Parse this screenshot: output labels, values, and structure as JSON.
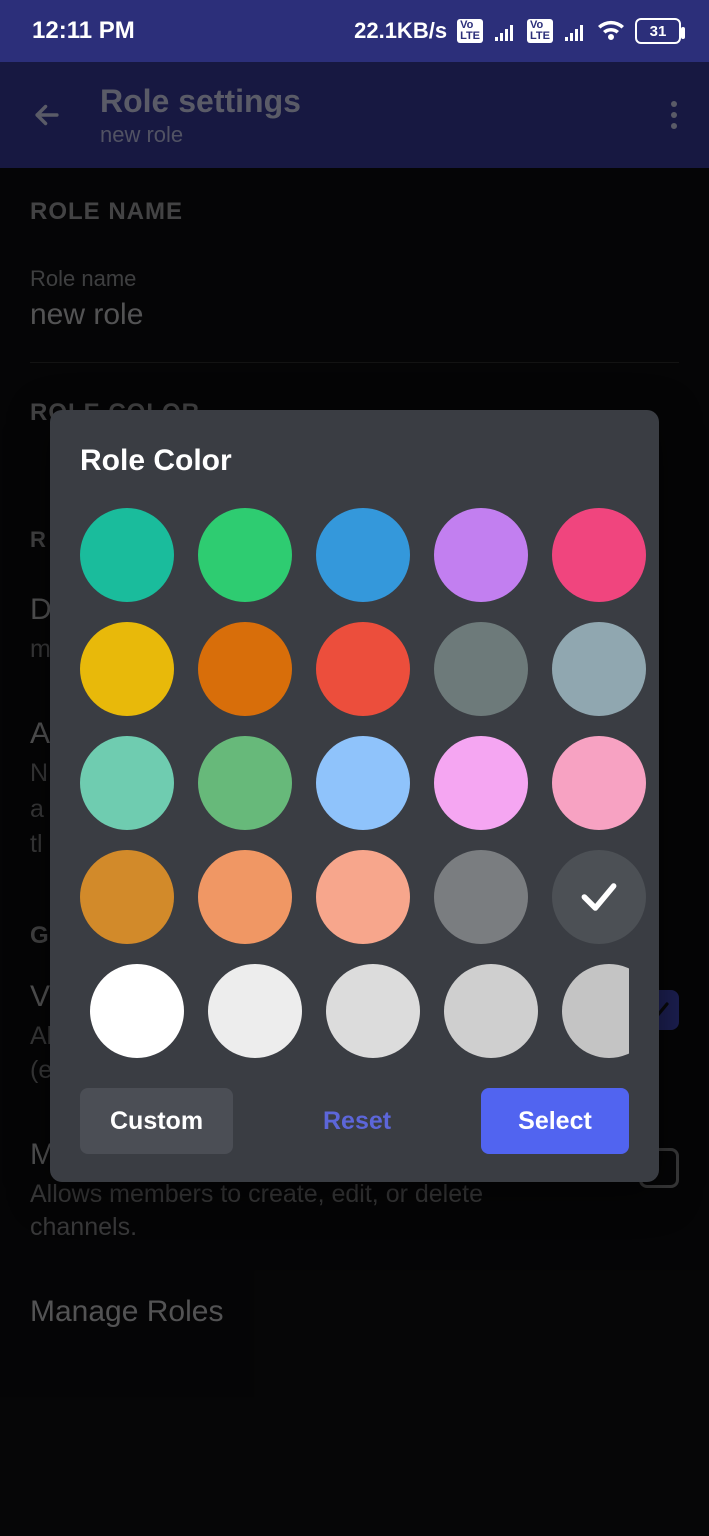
{
  "status": {
    "time": "12:11 PM",
    "speed": "22.1KB/s",
    "battery": "31"
  },
  "header": {
    "title": "Role settings",
    "subtitle": "new role"
  },
  "sections": {
    "roleName": {
      "header": "ROLE NAME",
      "fieldLabel": "Role name",
      "fieldValue": "new role"
    },
    "roleColor": {
      "header": "ROLE COLOR"
    },
    "roleSettings": {
      "header": "ROLE SETTINGS"
    }
  },
  "perms": {
    "display": {
      "prefix": "D",
      "descPrefix": "m"
    },
    "allowMention": {
      "prefix": "A",
      "line1": "N",
      "line2": "a",
      "line3": "tl"
    },
    "general": {
      "prefix": "G"
    },
    "viewChannels": {
      "title": "View Channels",
      "desc": "Allows members to view channels by default (excluding private channels).",
      "checked": true
    },
    "manageChannels": {
      "title": "Manage Channels",
      "desc": "Allows members to create, edit, or delete channels.",
      "checked": false
    },
    "manageRoles": {
      "title": "Manage Roles"
    }
  },
  "dialog": {
    "title": "Role Color",
    "buttons": {
      "custom": "Custom",
      "reset": "Reset",
      "select": "Select"
    },
    "colors": [
      [
        "#1abc9c",
        "#2ecc71",
        "#3498db",
        "#c27ff0",
        "#f0457e"
      ],
      [
        "#e8b90a",
        "#d86e0a",
        "#ec4e3c",
        "#6d7a7a",
        "#90a7b0"
      ],
      [
        "#6fccb0",
        "#67b97a",
        "#8fc3fb",
        "#f5a6f2",
        "#f7a2c2"
      ],
      [
        "#d28a2a",
        "#f09764",
        "#f7a68c",
        "#7a7d80",
        "#4c5055"
      ]
    ],
    "selectedIndex": [
      3,
      4
    ],
    "extraColors": [
      "#ffffff",
      "#ededed",
      "#dcdcdc",
      "#cfcfcf",
      "#c4c4c4"
    ]
  }
}
